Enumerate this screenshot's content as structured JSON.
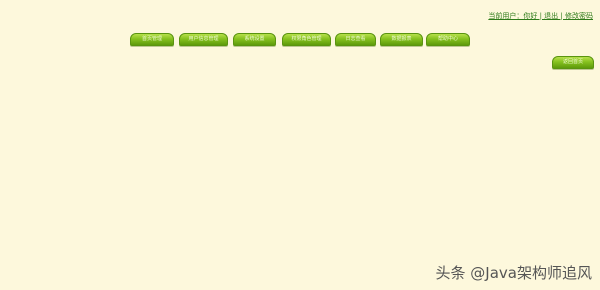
{
  "header": {
    "top_link_text": "当前用户：你好 | 退出 | 修改密码"
  },
  "nav": {
    "tabs": [
      {
        "label": "首页管理"
      },
      {
        "label": "用户信息管理"
      },
      {
        "label": "系统设置"
      },
      {
        "label": "权限角色管理"
      },
      {
        "label": "日志查看"
      },
      {
        "label": "数据报表"
      },
      {
        "label": "帮助中心"
      }
    ]
  },
  "side": {
    "button_label": "返回首页"
  },
  "watermark": {
    "text": "头条 @Java架构师追风"
  },
  "colors": {
    "background": "#fdf8dc",
    "tab_green": "#86c11f",
    "link_green": "#2d7a18"
  }
}
